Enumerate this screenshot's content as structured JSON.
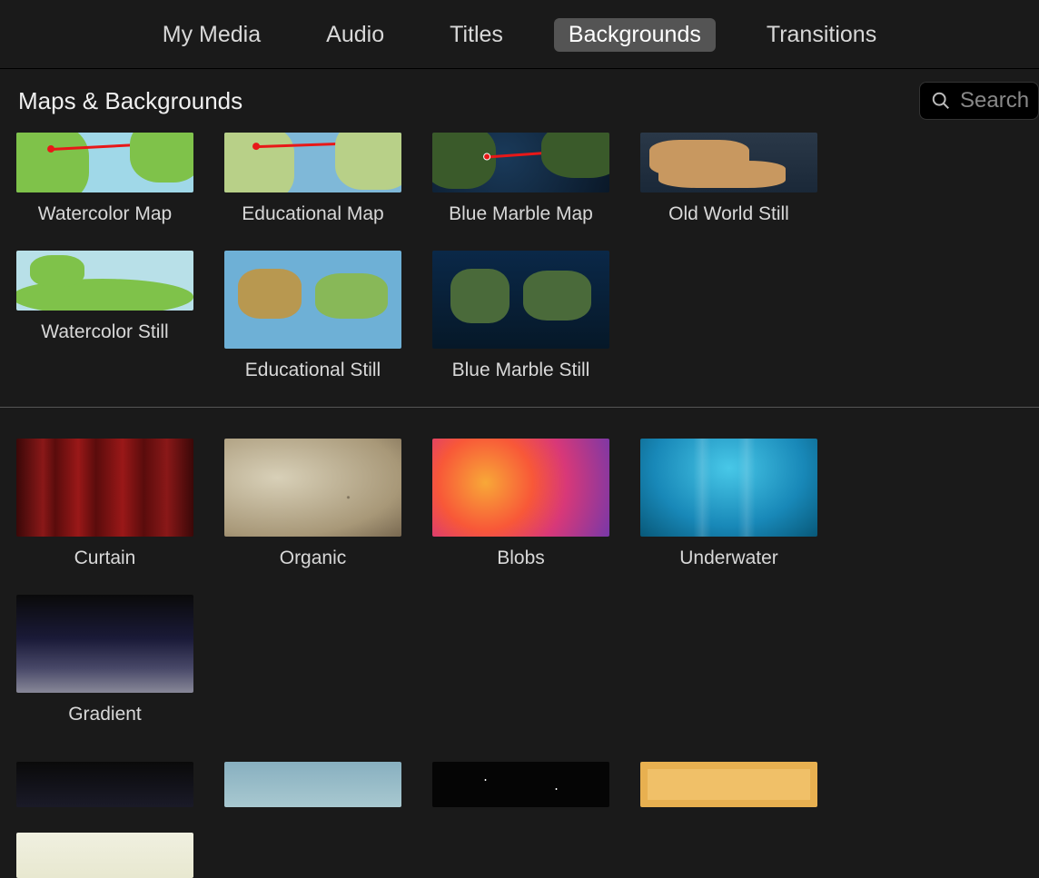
{
  "tabs": {
    "my_media": "My Media",
    "audio": "Audio",
    "titles": "Titles",
    "backgrounds": "Backgrounds",
    "transitions": "Transitions",
    "active": "backgrounds"
  },
  "section_title": "Maps & Backgrounds",
  "search": {
    "placeholder": "Search"
  },
  "maps": [
    {
      "label": "Watercolor Map",
      "thumb": "thumb-watercolor-map",
      "route": true
    },
    {
      "label": "Educational Map",
      "thumb": "thumb-educational-map",
      "route": true
    },
    {
      "label": "Blue Marble Map",
      "thumb": "thumb-blue-marble-map",
      "route": true
    },
    {
      "label": "Old World Still",
      "thumb": "thumb-old-world",
      "route": false
    },
    {
      "label": "Watercolor Still",
      "thumb": "thumb-watercolor-still",
      "route": false
    },
    {
      "label": "Educational Still",
      "thumb": "thumb-educational-still",
      "route": false
    },
    {
      "label": "Blue Marble Still",
      "thumb": "thumb-blue-marble-still",
      "route": false
    }
  ],
  "backgrounds": [
    {
      "label": "Curtain",
      "thumb": "thumb-curtain"
    },
    {
      "label": "Organic",
      "thumb": "thumb-organic"
    },
    {
      "label": "Blobs",
      "thumb": "thumb-blobs"
    },
    {
      "label": "Underwater",
      "thumb": "thumb-underwater"
    },
    {
      "label": "Gradient",
      "thumb": "thumb-gradient"
    }
  ],
  "backgrounds_partial": [
    {
      "thumb": "thumb-bg6"
    },
    {
      "thumb": "thumb-bg7"
    },
    {
      "thumb": "thumb-bg8"
    },
    {
      "thumb": "thumb-bg9"
    },
    {
      "thumb": "thumb-bg10"
    }
  ]
}
